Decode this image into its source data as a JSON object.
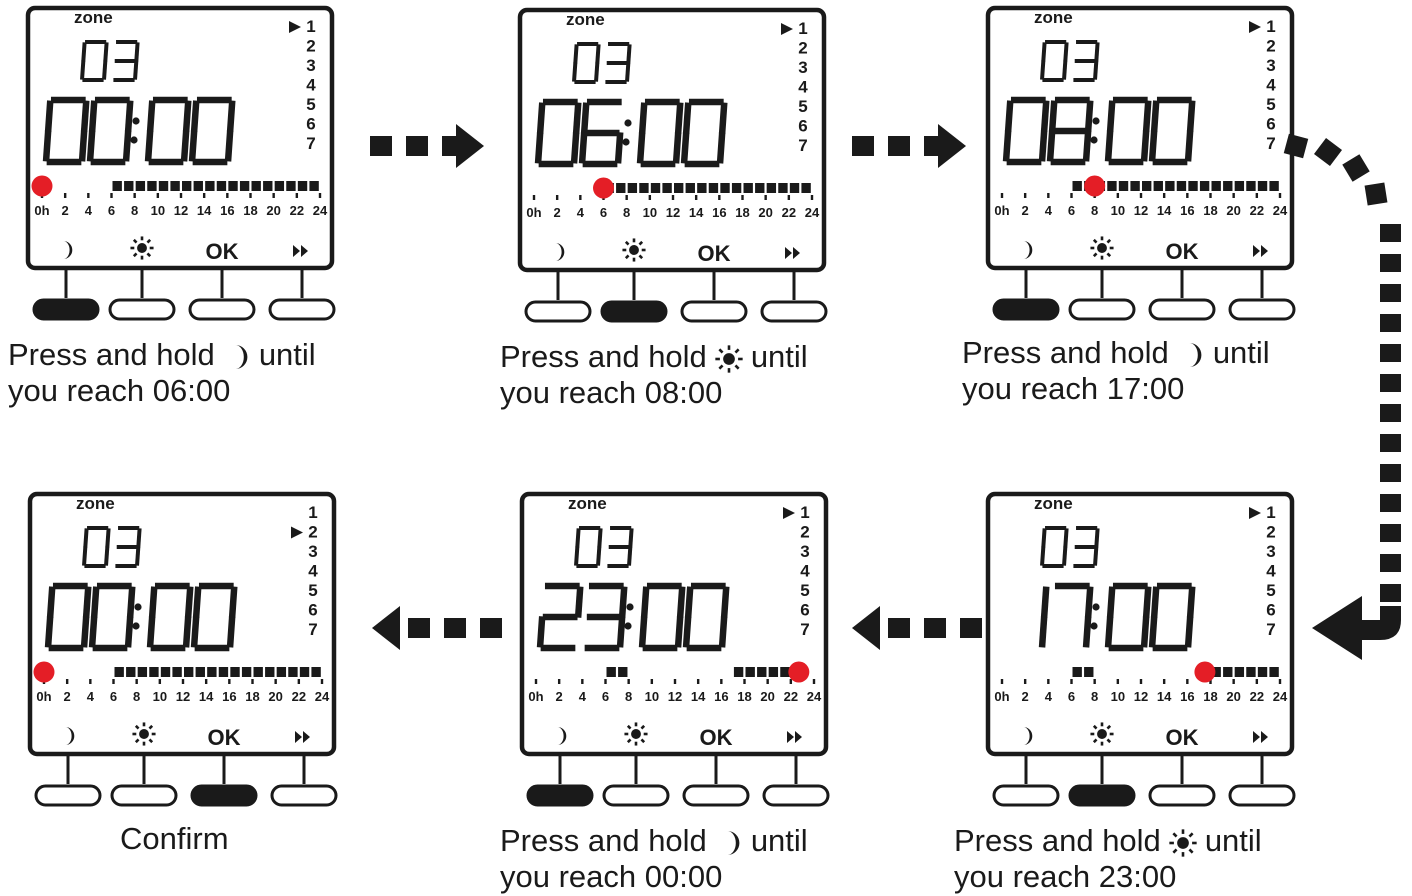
{
  "labels": {
    "zone": "zone",
    "zone_number": "03",
    "ok": "OK",
    "day_numbers": [
      "1",
      "2",
      "3",
      "4",
      "5",
      "6",
      "7"
    ],
    "hour_ticks": [
      "0h",
      "2",
      "4",
      "6",
      "8",
      "10",
      "12",
      "14",
      "16",
      "18",
      "20",
      "22",
      "24"
    ]
  },
  "button_icons": [
    "moon-icon",
    "sun-icon",
    "ok-label",
    "fast-forward-icon"
  ],
  "colors": {
    "marker": "#e41e26",
    "ink": "#1a1a1a",
    "background": "#ffffff"
  },
  "steps": [
    {
      "time": "00:00",
      "selected_day": 1,
      "marker_hour": 0,
      "pressed_button": 0,
      "comfort_blocks_hours": [
        [
          6,
          24
        ]
      ],
      "caption_parts": [
        "Press and hold",
        "until",
        "you reach 06:00"
      ],
      "caption_icon": "moon-icon"
    },
    {
      "time": "06:00",
      "selected_day": 1,
      "marker_hour": 6,
      "pressed_button": 1,
      "comfort_blocks_hours": [
        [
          6,
          24
        ]
      ],
      "caption_parts": [
        "Press and hold",
        "until",
        "you reach 08:00"
      ],
      "caption_icon": "sun-icon"
    },
    {
      "time": "08:00",
      "selected_day": 1,
      "marker_hour": 8,
      "pressed_button": 0,
      "comfort_blocks_hours": [
        [
          6,
          24
        ]
      ],
      "caption_parts": [
        "Press and hold",
        "until",
        "you reach 17:00"
      ],
      "caption_icon": "moon-icon"
    },
    {
      "time": "17:00",
      "selected_day": 1,
      "marker_hour": 17,
      "pressed_button": 1,
      "comfort_blocks_hours": [
        [
          6,
          8
        ],
        [
          17,
          24
        ]
      ],
      "caption_parts": [
        "Press and hold",
        "until",
        "you reach 23:00"
      ],
      "caption_icon": "sun-icon"
    },
    {
      "time": "23:00",
      "selected_day": 1,
      "marker_hour": 22,
      "pressed_button": 0,
      "comfort_blocks_hours": [
        [
          6,
          8
        ],
        [
          17,
          23
        ]
      ],
      "caption_parts": [
        "Press and hold",
        "until",
        "you reach 00:00"
      ],
      "caption_icon": "moon-icon"
    },
    {
      "time": "00:00",
      "selected_day": 2,
      "marker_hour": 0,
      "pressed_button": 2,
      "comfort_blocks_hours": [
        [
          6,
          24
        ]
      ],
      "caption_parts": [
        "Confirm"
      ],
      "caption_icon": ""
    }
  ]
}
